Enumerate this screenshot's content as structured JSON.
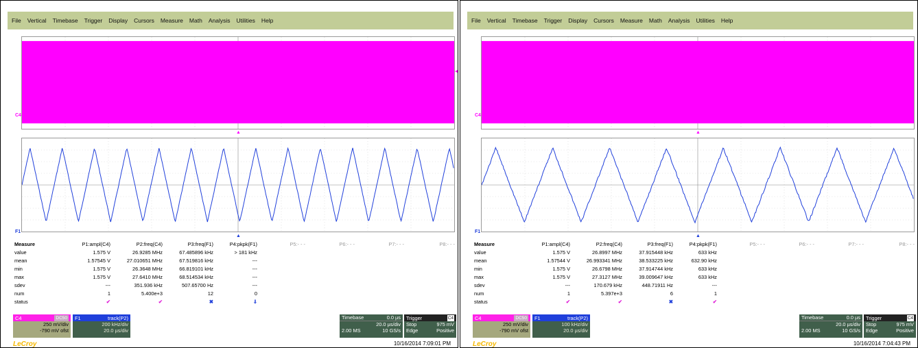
{
  "menu": [
    "File",
    "Vertical",
    "Timebase",
    "Trigger",
    "Display",
    "Cursors",
    "Measure",
    "Math",
    "Analysis",
    "Utilities",
    "Help"
  ],
  "colors": {
    "c4": "#ff00ff",
    "f1": "#1f3fdb",
    "menubar": "#c2cd97"
  },
  "panels": [
    {
      "trace_labels": {
        "c4": "C4",
        "f1": "F1"
      },
      "measure": {
        "title": "Measure",
        "columns": [
          "P1:ampl(C4)",
          "P2:freq(C4)",
          "P3:freq(F1)",
          "P4:pkpk(F1)",
          "P5:- - -",
          "P6:- - -",
          "P7:- - -",
          "P8:- - -"
        ],
        "rows": [
          {
            "label": "value",
            "cells": [
              "1.575 V",
              "26.9285 MHz",
              "67.485896 kHz",
              "> 181 kHz"
            ]
          },
          {
            "label": "mean",
            "cells": [
              "1.57545 V",
              "27.010651 MHz",
              "67.519816 kHz",
              "---"
            ]
          },
          {
            "label": "min",
            "cells": [
              "1.575 V",
              "26.3648 MHz",
              "66.819101 kHz",
              "---"
            ]
          },
          {
            "label": "max",
            "cells": [
              "1.575 V",
              "27.6410 MHz",
              "68.514534 kHz",
              "---"
            ]
          },
          {
            "label": "sdev",
            "cells": [
              "---",
              "351.936 kHz",
              "507.65700 Hz",
              "---"
            ]
          },
          {
            "label": "num",
            "cells": [
              "1",
              "5.400e+3",
              "12",
              "0"
            ]
          },
          {
            "label": "status",
            "cells": [
              "✔",
              "✔",
              "✖",
              "⇓"
            ]
          }
        ]
      },
      "ch_box": {
        "name": "C4",
        "coupling": "DC50",
        "scale": "250 mV/div",
        "offset": "-790 mV ofst"
      },
      "f1_box": {
        "name": "F1",
        "func": "track(P2)",
        "scale": "200 kHz/div",
        "time": "20.0 µs/div"
      },
      "timebase": {
        "title": "Timebase",
        "delay": "0.0 µs",
        "per_div": "20.0 µs/div",
        "samples": "2.00 MS",
        "rate": "10 GS/s"
      },
      "trigger": {
        "title": "Trigger",
        "ch": "C4",
        "mode": "Stop",
        "level": "975 mV",
        "type": "Edge",
        "slope": "Positive"
      },
      "logo": "LeCroy",
      "timestamp": "10/16/2014 7:09:01 PM"
    },
    {
      "trace_labels": {
        "c4": "C4",
        "f1": "F1"
      },
      "measure": {
        "title": "Measure",
        "columns": [
          "P1:ampl(C4)",
          "P2:freq(C4)",
          "P3:freq(F1)",
          "P4:pkpk(F1)",
          "P5:- - -",
          "P6:- - -",
          "P7:- - -",
          "P8:- - -"
        ],
        "rows": [
          {
            "label": "value",
            "cells": [
              "1.575 V",
              "26.8997 MHz",
              "37.915448 kHz",
              "633 kHz"
            ]
          },
          {
            "label": "mean",
            "cells": [
              "1.57544 V",
              "26.993341 MHz",
              "38.533225 kHz",
              "632.90 kHz"
            ]
          },
          {
            "label": "min",
            "cells": [
              "1.575 V",
              "26.6798 MHz",
              "37.914744 kHz",
              "633 kHz"
            ]
          },
          {
            "label": "max",
            "cells": [
              "1.575 V",
              "27.3127 MHz",
              "39.009647 kHz",
              "633 kHz"
            ]
          },
          {
            "label": "sdev",
            "cells": [
              "---",
              "170.679 kHz",
              "448.71911 Hz",
              "---"
            ]
          },
          {
            "label": "num",
            "cells": [
              "1",
              "5.397e+3",
              "6",
              "1"
            ]
          },
          {
            "label": "status",
            "cells": [
              "✔",
              "✔",
              "✖",
              "✔"
            ]
          }
        ]
      },
      "ch_box": {
        "name": "C4",
        "coupling": "DC50",
        "scale": "250 mV/div",
        "offset": "-790 mV ofst"
      },
      "f1_box": {
        "name": "F1",
        "func": "track(P2)",
        "scale": "100 kHz/div",
        "time": "20.0 µs/div"
      },
      "timebase": {
        "title": "Timebase",
        "delay": "0.0 µs",
        "per_div": "20.0 µs/div",
        "samples": "2.00 MS",
        "rate": "10 GS/s"
      },
      "trigger": {
        "title": "Trigger",
        "ch": "C4",
        "mode": "Stop",
        "level": "975 mV",
        "type": "Edge",
        "slope": "Positive"
      },
      "logo": "LeCroy",
      "timestamp": "10/16/2014 7:04:43 PM"
    }
  ]
}
